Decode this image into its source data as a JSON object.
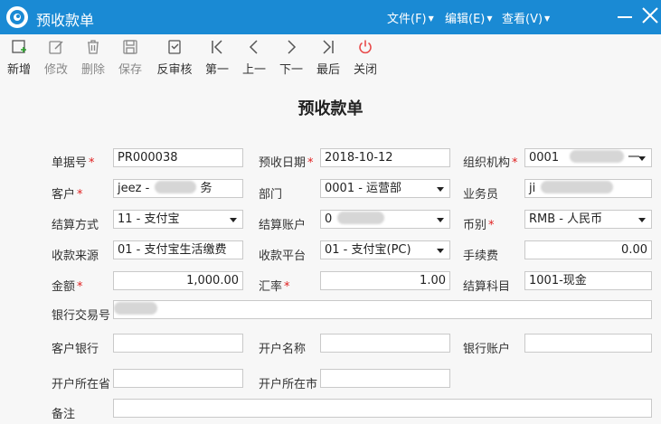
{
  "window": {
    "title": "预收款单"
  },
  "menus": [
    {
      "label": "文件(F)"
    },
    {
      "label": "编辑(E)"
    },
    {
      "label": "查看(V)"
    }
  ],
  "toolbar": {
    "new": "新增",
    "edit": "修改",
    "delete": "删除",
    "save": "保存",
    "unaudit": "反审核",
    "first": "第一",
    "prev": "上一",
    "next": "下一",
    "last": "最后",
    "close": "关闭"
  },
  "form": {
    "title": "预收款单",
    "labels": {
      "bill_no": "单据号",
      "date": "预收日期",
      "org": "组织机构",
      "customer": "客户",
      "dept": "部门",
      "salesman": "业务员",
      "settle_method": "结算方式",
      "settle_account": "结算账户",
      "currency": "币别",
      "source": "收款来源",
      "platform": "收款平台",
      "fee": "手续费",
      "amount": "金额",
      "rate": "汇率",
      "subject": "结算科目",
      "bank_txn": "银行交易号",
      "cust_bank": "客户银行",
      "acct_name": "开户名称",
      "bank_acct": "银行账户",
      "province": "开户所在省",
      "city": "开户所在市",
      "remark": "备注"
    },
    "values": {
      "bill_no": "PR000038",
      "date": "2018-10-12",
      "org_prefix": "0001",
      "org_suffix": "一",
      "customer_prefix": "jeez -",
      "customer_suffix": "务",
      "dept": "0001 - 运营部",
      "salesman_prefix": "ji",
      "settle_method": "11 - 支付宝",
      "settle_account_prefix": "0",
      "currency": "RMB - 人民币",
      "source": "01 - 支付宝生活缴费",
      "platform": "01 - 支付宝(PC)",
      "fee": "0.00",
      "amount": "1,000.00",
      "rate": "1.00",
      "subject": "1001-现金"
    }
  }
}
